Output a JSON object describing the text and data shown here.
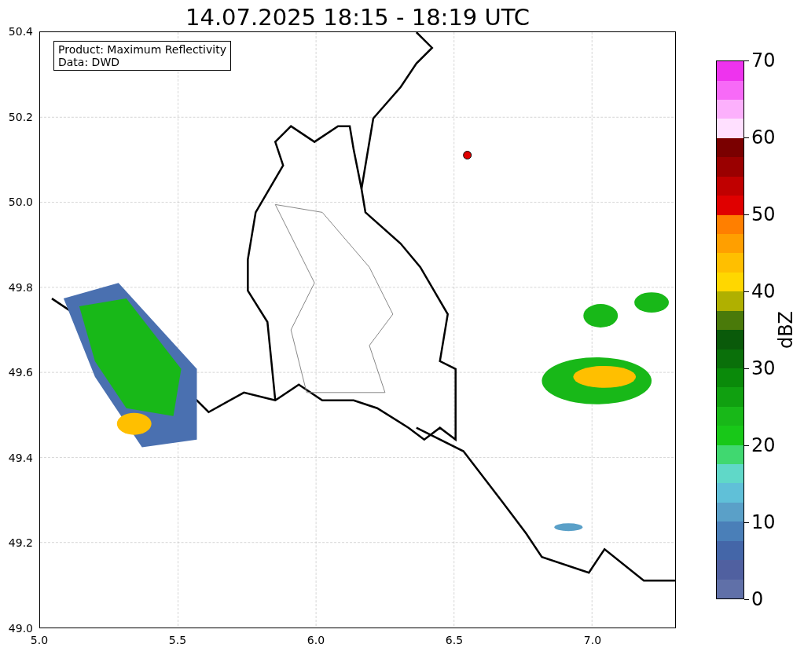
{
  "title": "14.07.2025 18:15 - 18:19 UTC",
  "info_box": [
    "Product: Maximum Reflectivity",
    "Data: DWD"
  ],
  "x_ticks": [
    "5.0",
    "5.5",
    "6.0",
    "6.5",
    "7.0"
  ],
  "y_ticks": [
    "50.4",
    "50.2",
    "50.0",
    "49.8",
    "49.6",
    "49.4",
    "49.2",
    "49.0"
  ],
  "colorbar": {
    "label": "dBZ",
    "ticks": [
      "70",
      "60",
      "50",
      "40",
      "30",
      "20",
      "10",
      "0"
    ],
    "bands": [
      {
        "color": "#6070a8"
      },
      {
        "color": "#5060a0"
      },
      {
        "color": "#4466a8"
      },
      {
        "color": "#4a7fb8"
      },
      {
        "color": "#5aa0c8"
      },
      {
        "color": "#60c0d8"
      },
      {
        "color": "#60d8c8"
      },
      {
        "color": "#40d870"
      },
      {
        "color": "#18c818"
      },
      {
        "color": "#18b818"
      },
      {
        "color": "#10a010"
      },
      {
        "color": "#0a8a0a"
      },
      {
        "color": "#0a700a"
      },
      {
        "color": "#0a5a0a"
      },
      {
        "color": "#4a7a0a"
      },
      {
        "color": "#b0b000"
      },
      {
        "color": "#ffd700"
      },
      {
        "color": "#ffbf00"
      },
      {
        "color": "#ff9f00"
      },
      {
        "color": "#ff7f00"
      },
      {
        "color": "#e00000"
      },
      {
        "color": "#c00000"
      },
      {
        "color": "#9a0000"
      },
      {
        "color": "#7a0000"
      },
      {
        "color": "#ffe0ff"
      },
      {
        "color": "#fcb0fc"
      },
      {
        "color": "#f76af7"
      },
      {
        "color": "#ee33ee"
      }
    ]
  }
}
